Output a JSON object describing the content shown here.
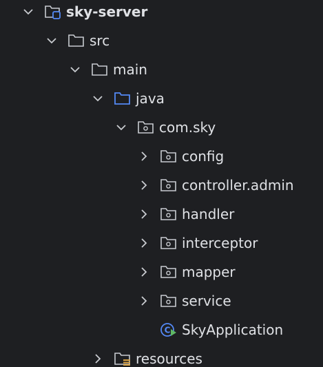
{
  "tree": {
    "root": {
      "label": "sky-server"
    },
    "src": {
      "label": "src"
    },
    "main": {
      "label": "main"
    },
    "java": {
      "label": "java"
    },
    "package": {
      "label": "com.sky"
    },
    "packages": [
      {
        "label": "config"
      },
      {
        "label": "controller.admin"
      },
      {
        "label": "handler"
      },
      {
        "label": "interceptor"
      },
      {
        "label": "mapper"
      },
      {
        "label": "service"
      }
    ],
    "app_class": {
      "label": "SkyApplication"
    },
    "resources": {
      "label": "resources"
    }
  },
  "colors": {
    "background": "#1e1f22",
    "text": "#dfe1e5",
    "folder_stroke": "#c9ccd1",
    "java_folder": "#548af7",
    "spring_green": "#5fb865",
    "resources_badge": "#d9a343"
  }
}
